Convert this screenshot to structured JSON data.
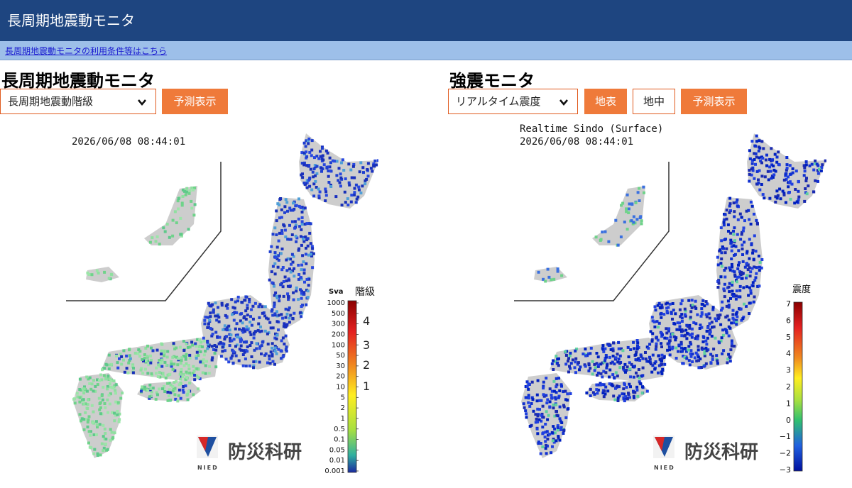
{
  "header": {
    "title": "長周期地震動モニタ"
  },
  "notice": {
    "link_text": "長周期地震動モニタの利用条件等はこちら"
  },
  "left_panel": {
    "title": "長周期地震動モニタ",
    "select_value": "長周期地震動階級",
    "predict_button": "予測表示",
    "map": {
      "timestamp": "2026/06/08 08:44:01",
      "legend_left_header": "Sva",
      "legend_right_header": "階級",
      "sva_ticks": [
        "1000",
        "500",
        "300",
        "200",
        "100",
        "50",
        "30",
        "20",
        "10",
        "5",
        "2",
        "1",
        "0.5",
        "0.1",
        "0.05",
        "0.01",
        "0.001"
      ],
      "class_ticks": [
        "4",
        "3",
        "2",
        "1"
      ],
      "logo_text": "防災科研",
      "logo_sub": "NIED"
    }
  },
  "right_panel": {
    "title": "強震モニタ",
    "select_value": "リアルタイム震度",
    "surface_button": "地表",
    "underground_button": "地中",
    "predict_button": "予測表示",
    "map": {
      "caption": "Realtime Sindo (Surface)",
      "timestamp": "2026/06/08 08:44:01",
      "legend_header": "震度",
      "ticks": [
        "7",
        "6",
        "5",
        "4",
        "3",
        "2",
        "1",
        "0",
        "−1",
        "−2",
        "−3"
      ],
      "logo_text": "防災科研",
      "logo_sub": "NIED"
    }
  },
  "colors": {
    "header_bg": "#1e4580",
    "link_bar_bg": "#9dbfe9",
    "accent_orange": "#ef7a3a",
    "station_blue": "#1f3fd0",
    "station_green": "#6fd38a"
  }
}
